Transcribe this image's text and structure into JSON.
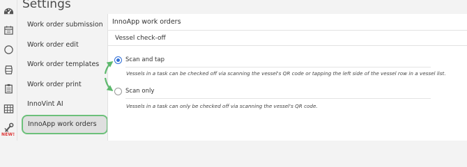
{
  "app": {
    "page_title": "Settings"
  },
  "icon_rail": {
    "icons": [
      "dashboard-icon",
      "calendar-icon",
      "circle-icon",
      "barrel-icon",
      "clipboard-icon",
      "grid-icon",
      "tools-icon"
    ],
    "new_badge": "NEW!"
  },
  "submenu": {
    "items": [
      {
        "label": "Work order submission"
      },
      {
        "label": "Work order edit"
      },
      {
        "label": "Work order templates"
      },
      {
        "label": "Work order print"
      },
      {
        "label": "InnoVint AI"
      },
      {
        "label": "InnoApp work orders",
        "active": true
      }
    ]
  },
  "panel": {
    "header": "InnoApp work orders",
    "section_title": "Vessel check-off",
    "options": [
      {
        "label": "Scan and tap",
        "selected": true,
        "description": "Vessels in a task can be checked off via scanning the vessel's QR code or tapping the left side of the vessel row in a vessel list."
      },
      {
        "label": "Scan only",
        "selected": false,
        "description": "Vessels in a task can only be checked off via scanning the vessel's QR code."
      }
    ]
  },
  "colors": {
    "accent_green": "#6cc07a",
    "radio_blue": "#2f6fd8",
    "new_badge_red": "#d33333"
  }
}
